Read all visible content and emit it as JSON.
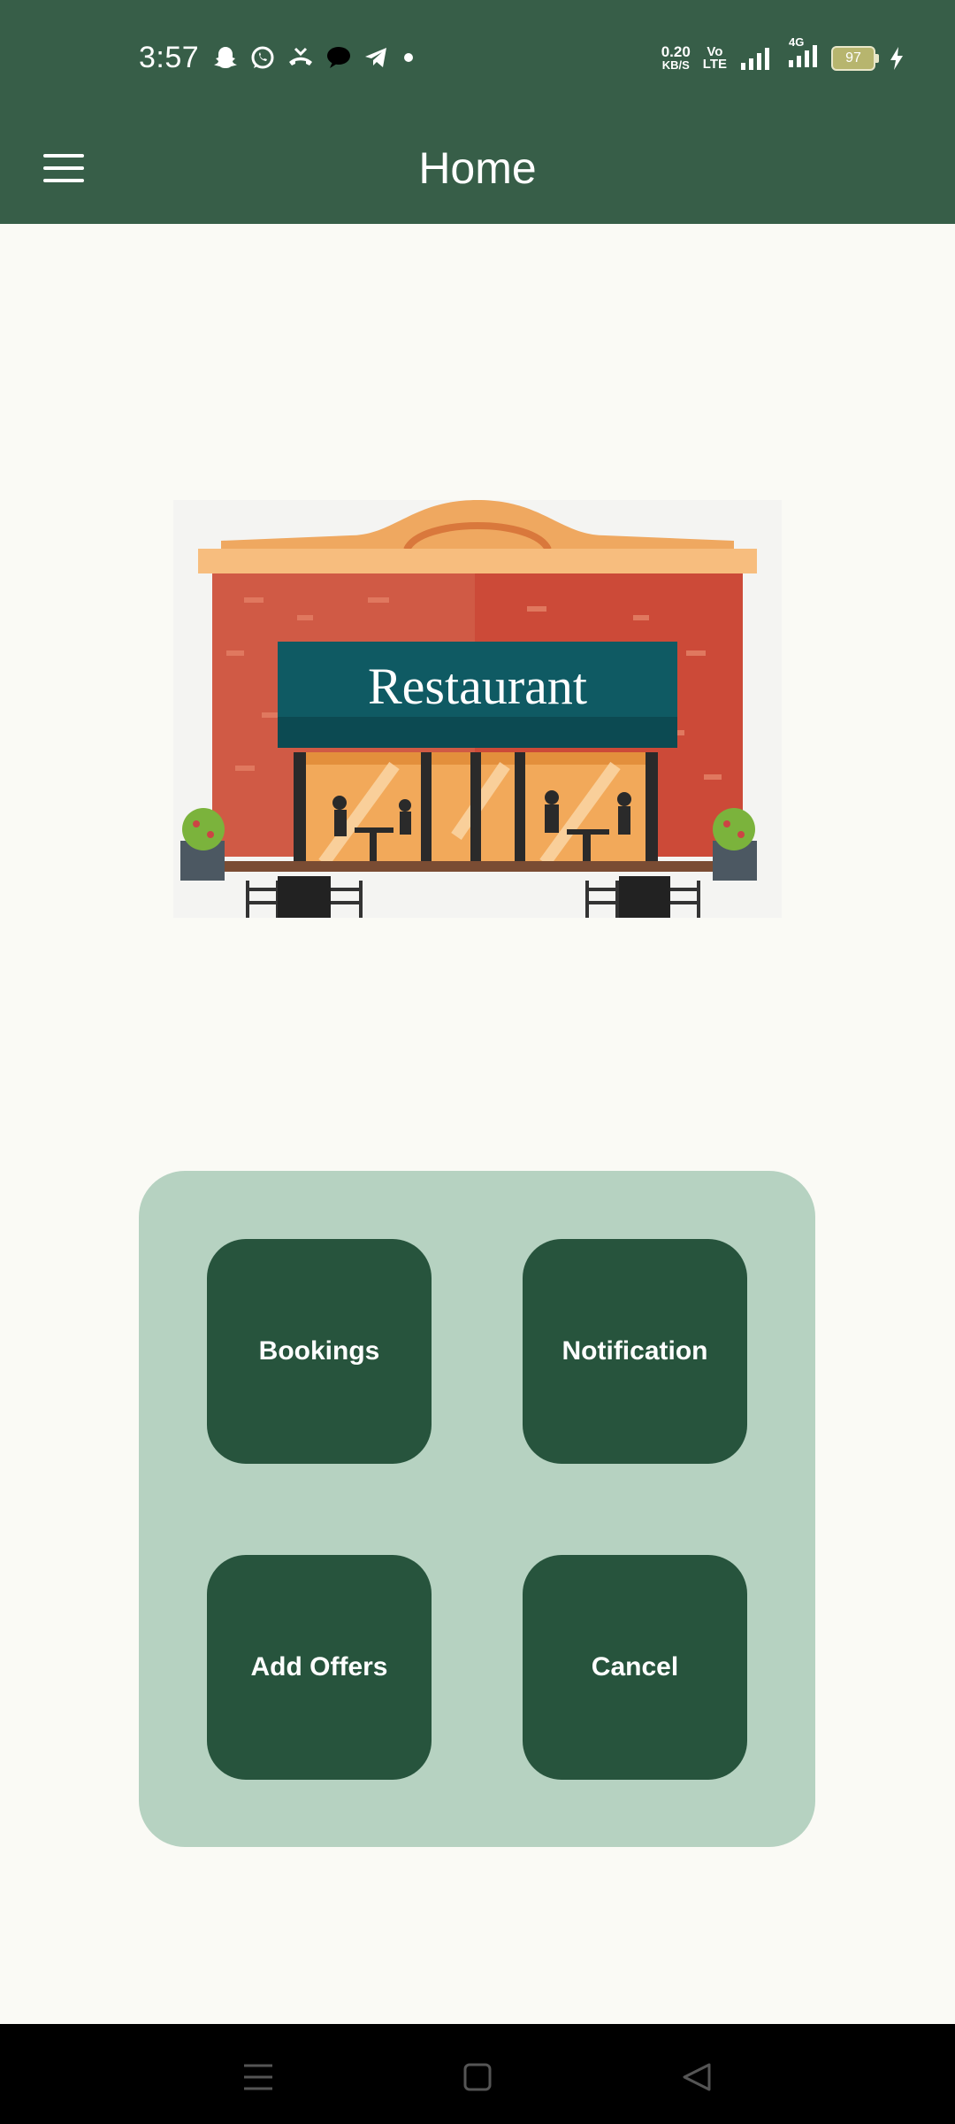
{
  "status_bar": {
    "time": "3:57",
    "net_speed_value": "0.20",
    "net_speed_unit": "KB/S",
    "volte_top": "Vo",
    "volte_bottom": "LTE",
    "network_type": "4G",
    "battery": "97",
    "icons": [
      "snapchat-icon",
      "whatsapp-icon",
      "missed-call-icon",
      "chat-bubble-icon",
      "telegram-icon",
      "dot-icon",
      "signal-icon",
      "signal-4g-icon",
      "battery-icon",
      "charging-icon"
    ]
  },
  "app_bar": {
    "title": "Home",
    "menu_icon": "hamburger-menu-icon"
  },
  "hero": {
    "sign_text": "Restaurant"
  },
  "actions": {
    "bookings": "Bookings",
    "notification": "Notification",
    "add_offers": "Add Offers",
    "cancel": "Cancel"
  },
  "colors": {
    "app_bar": "#375e48",
    "tile": "#27543d",
    "panel": "#b6d2c1",
    "background": "#fafaf5"
  },
  "nav_bar": {
    "icons": [
      "recents-icon",
      "home-icon",
      "back-icon"
    ]
  }
}
